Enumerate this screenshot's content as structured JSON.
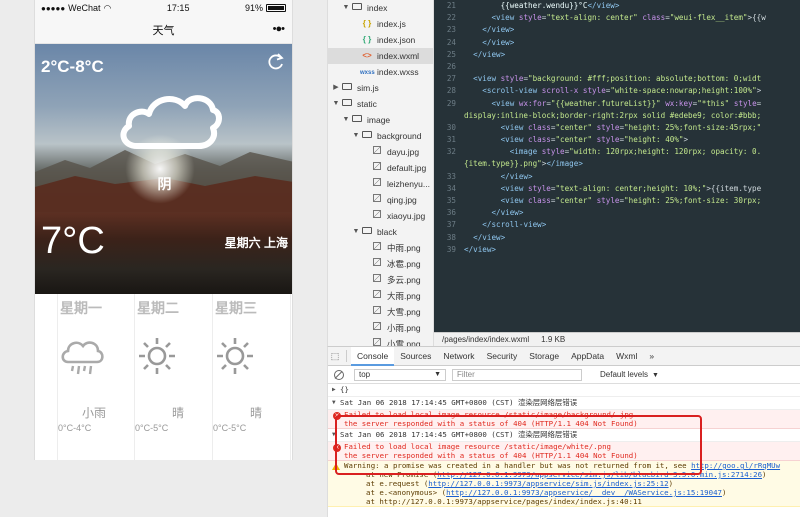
{
  "phone": {
    "status": {
      "carrier": "WeChat",
      "time": "17:15",
      "battery": "91%"
    },
    "nav_title": "天气",
    "nav_more": "•●•",
    "current": {
      "temp_range": "2°C-8°C",
      "weather": "阴",
      "temp": "7°C",
      "date_city": "星期六 上海"
    },
    "future": [
      {
        "weekday": "星期一",
        "type": "小雨",
        "range": "0°C-4°C",
        "icon": "rain-icon"
      },
      {
        "weekday": "星期二",
        "type": "晴",
        "range": "0°C-5°C",
        "icon": "sun-icon"
      },
      {
        "weekday": "星期三",
        "type": "晴",
        "range": "0°C-5°C",
        "icon": "sun-icon"
      }
    ]
  },
  "filetree": [
    {
      "label": "index",
      "kind": "folder",
      "indent": 1,
      "open": true
    },
    {
      "label": "index.js",
      "kind": "js",
      "indent": 2
    },
    {
      "label": "index.json",
      "kind": "json",
      "indent": 2
    },
    {
      "label": "index.wxml",
      "kind": "wxml",
      "indent": 2,
      "active": true
    },
    {
      "label": "index.wxss",
      "kind": "wxss",
      "indent": 2
    },
    {
      "label": "sim.js",
      "kind": "folder",
      "indent": 0,
      "open": false
    },
    {
      "label": "static",
      "kind": "folder",
      "indent": 0,
      "open": true
    },
    {
      "label": "image",
      "kind": "folder",
      "indent": 1,
      "open": true
    },
    {
      "label": "background",
      "kind": "folder",
      "indent": 2,
      "open": true
    },
    {
      "label": "dayu.jpg",
      "kind": "img",
      "indent": 3
    },
    {
      "label": "default.jpg",
      "kind": "img",
      "indent": 3
    },
    {
      "label": "leizhenyu...",
      "kind": "img",
      "indent": 3
    },
    {
      "label": "qing.jpg",
      "kind": "img",
      "indent": 3
    },
    {
      "label": "xiaoyu.jpg",
      "kind": "img",
      "indent": 3
    },
    {
      "label": "black",
      "kind": "folder",
      "indent": 2,
      "open": true
    },
    {
      "label": "中雨.png",
      "kind": "img",
      "indent": 3
    },
    {
      "label": "冰雹.png",
      "kind": "img",
      "indent": 3
    },
    {
      "label": "多云.png",
      "kind": "img",
      "indent": 3
    },
    {
      "label": "大雨.png",
      "kind": "img",
      "indent": 3
    },
    {
      "label": "大雪.png",
      "kind": "img",
      "indent": 3
    },
    {
      "label": "小雨.png",
      "kind": "img",
      "indent": 3
    },
    {
      "label": "小雪.png",
      "kind": "img",
      "indent": 3
    }
  ],
  "editor": {
    "lines": [
      {
        "n": "21",
        "html": "        <span class='pln'>{{weather.wendu}}°C</span><span class='tag'>&lt;/view&gt;</span>"
      },
      {
        "n": "22",
        "html": "      <span class='tag'>&lt;view</span> <span class='attr'>style</span>=<span class='str'>\"text-align: center\"</span> <span class='attr'>class</span>=<span class='str'>\"weui-flex__item\"</span>&gt;{{w"
      },
      {
        "n": "23",
        "html": "    <span class='tag'>&lt;/view&gt;</span>"
      },
      {
        "n": "24",
        "html": "    <span class='tag'>&lt;/view&gt;</span>"
      },
      {
        "n": "25",
        "html": "  <span class='tag'>&lt;/view&gt;</span>"
      },
      {
        "n": "26",
        "html": ""
      },
      {
        "n": "27",
        "html": "  <span class='tag'>&lt;view</span> <span class='attr'>style</span>=<span class='str'>\"background: #fff;position: absolute;bottom: 0;widt</span>"
      },
      {
        "n": "28",
        "html": "    <span class='tag'>&lt;scroll-view</span> <span class='attr'>scroll-x</span> <span class='attr'>style</span>=<span class='str'>\"white-space:nowrap;height:100%\"</span>&gt;"
      },
      {
        "n": "29",
        "html": "      <span class='tag'>&lt;view</span> <span class='attr'>wx:for</span>=<span class='str'>\"{{weather.futureList}}\"</span> <span class='attr'>wx:key</span>=<span class='str'>\"*this\"</span> <span class='attr'>style</span>="
      },
      {
        "n": "",
        "html": "<span class='str'>display:inline-block;border-right:2rpx solid #edebe9; color:#bbb;</span>"
      },
      {
        "n": "30",
        "html": "        <span class='tag'>&lt;view</span> <span class='attr'>class</span>=<span class='str'>\"center\"</span> <span class='attr'>style</span>=<span class='str'>\"height: 25%;font-size:45rpx;\"</span>"
      },
      {
        "n": "31",
        "html": "        <span class='tag'>&lt;view</span> <span class='attr'>class</span>=<span class='str'>\"center\"</span> <span class='attr'>style</span>=<span class='str'>\"height: 40%\"</span>&gt;"
      },
      {
        "n": "32",
        "html": "          <span class='tag'>&lt;image</span> <span class='attr'>style</span>=<span class='str'>\"width: 120rpx;height: 120rpx; opacity: 0.</span>"
      },
      {
        "n": "",
        "html": "<span class='str'>{item.type}}.png\"</span>&gt;<span class='tag'>&lt;/image&gt;</span>"
      },
      {
        "n": "33",
        "html": "        <span class='tag'>&lt;/view&gt;</span>"
      },
      {
        "n": "34",
        "html": "        <span class='tag'>&lt;view</span> <span class='attr'>style</span>=<span class='str'>\"text-align: center;height: 10%;\"</span>&gt;{{item.type"
      },
      {
        "n": "35",
        "html": "        <span class='tag'>&lt;view</span> <span class='attr'>class</span>=<span class='str'>\"center\"</span> <span class='attr'>style</span>=<span class='str'>\"height: 25%;font-size: 30rpx;</span>"
      },
      {
        "n": "36",
        "html": "      <span class='tag'>&lt;/view&gt;</span>"
      },
      {
        "n": "37",
        "html": "    <span class='tag'>&lt;/scroll-view&gt;</span>"
      },
      {
        "n": "38",
        "html": "  <span class='tag'>&lt;/view&gt;</span>"
      },
      {
        "n": "39",
        "html": "<span class='tag'>&lt;/view&gt;</span>"
      }
    ],
    "status_path": "/pages/index/index.wxml",
    "status_size": "1.9 KB"
  },
  "devtools": {
    "tabs": [
      "Console",
      "Sources",
      "Network",
      "Security",
      "Storage",
      "AppData",
      "Wxml"
    ],
    "active_tab": "Console",
    "more": "»",
    "context": "top",
    "filter_placeholder": "Filter",
    "levels": "Default levels",
    "obj": "{}",
    "entries": [
      {
        "kind": "group",
        "text": "Sat Jan 06 2018 17:14:45 GMT+0800 (CST) 渲染层网络层错误"
      },
      {
        "kind": "error",
        "l1": "Failed to load local image resource /static/image/background/.jpg",
        "l2": "the server responded with a status of 404 (HTTP/1.1 404 Not Found)"
      },
      {
        "kind": "group",
        "text": "Sat Jan 06 2018 17:14:45 GMT+0800 (CST) 渲染层网络层错误"
      },
      {
        "kind": "error",
        "l1": "Failed to load local image resource /static/image/white/.png",
        "l2": "the server responded with a status of 404 (HTTP/1.1 404 Not Found)"
      }
    ],
    "warning": {
      "l1_text": "Warning: a promise was created in a handler but was not returned from it, see ",
      "l1_link": "http://goo.gl/rRqMUw",
      "l2_text": "at new Promise (",
      "l2_link": "http://127.0.0.1:9973/appservice/sim.js/lib/bluebird-3.5.0.min.js:2714:26",
      "l2_end": ")",
      "l3_text": "at e.request (",
      "l3_link": "http://127.0.0.1:9973/appservice/sim.js/index.js:25:12",
      "l3_end": ")",
      "l4_text": "at e.<anonymous> (",
      "l4_link": "http://127.0.0.1:9973/appservice/__dev__/WAService.js:15:19047",
      "l4_end": ")",
      "l5_text": "at http://127.0.0.1:9973/appservice/pages/index/index.js:40:11"
    }
  },
  "colors": {
    "error": "#e0281e",
    "highlight": "#d92020",
    "editor_bg": "#263238"
  }
}
